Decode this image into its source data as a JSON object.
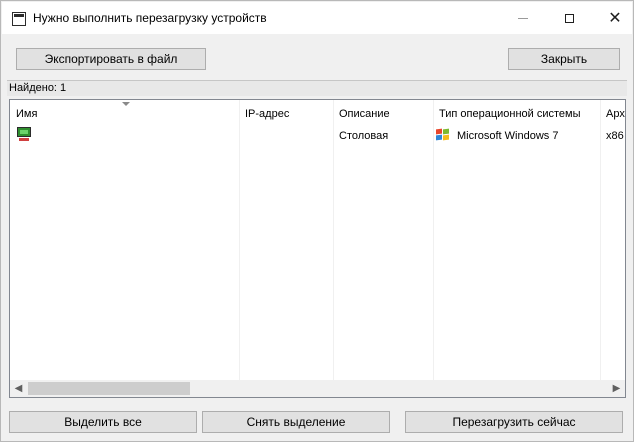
{
  "window": {
    "title": "Нужно выполнить перезагрузку устройств"
  },
  "toolbar": {
    "export_label": "Экспортировать в файл",
    "close_label": "Закрыть"
  },
  "status": {
    "found_text": "Найдено: 1"
  },
  "table": {
    "columns": [
      "Имя",
      "IP-адрес",
      "Описание",
      "Тип операционной системы",
      "Арх"
    ],
    "rows": [
      {
        "icon": "computer-icon",
        "name": "",
        "ip": "",
        "description": "Столовая",
        "os_icon": "windows-logo-icon",
        "os": "Microsoft Windows 7",
        "arch": "x86"
      }
    ]
  },
  "footer": {
    "select_all_label": "Выделить все",
    "deselect_label": "Снять выделение",
    "reboot_label": "Перезагрузить сейчас"
  }
}
